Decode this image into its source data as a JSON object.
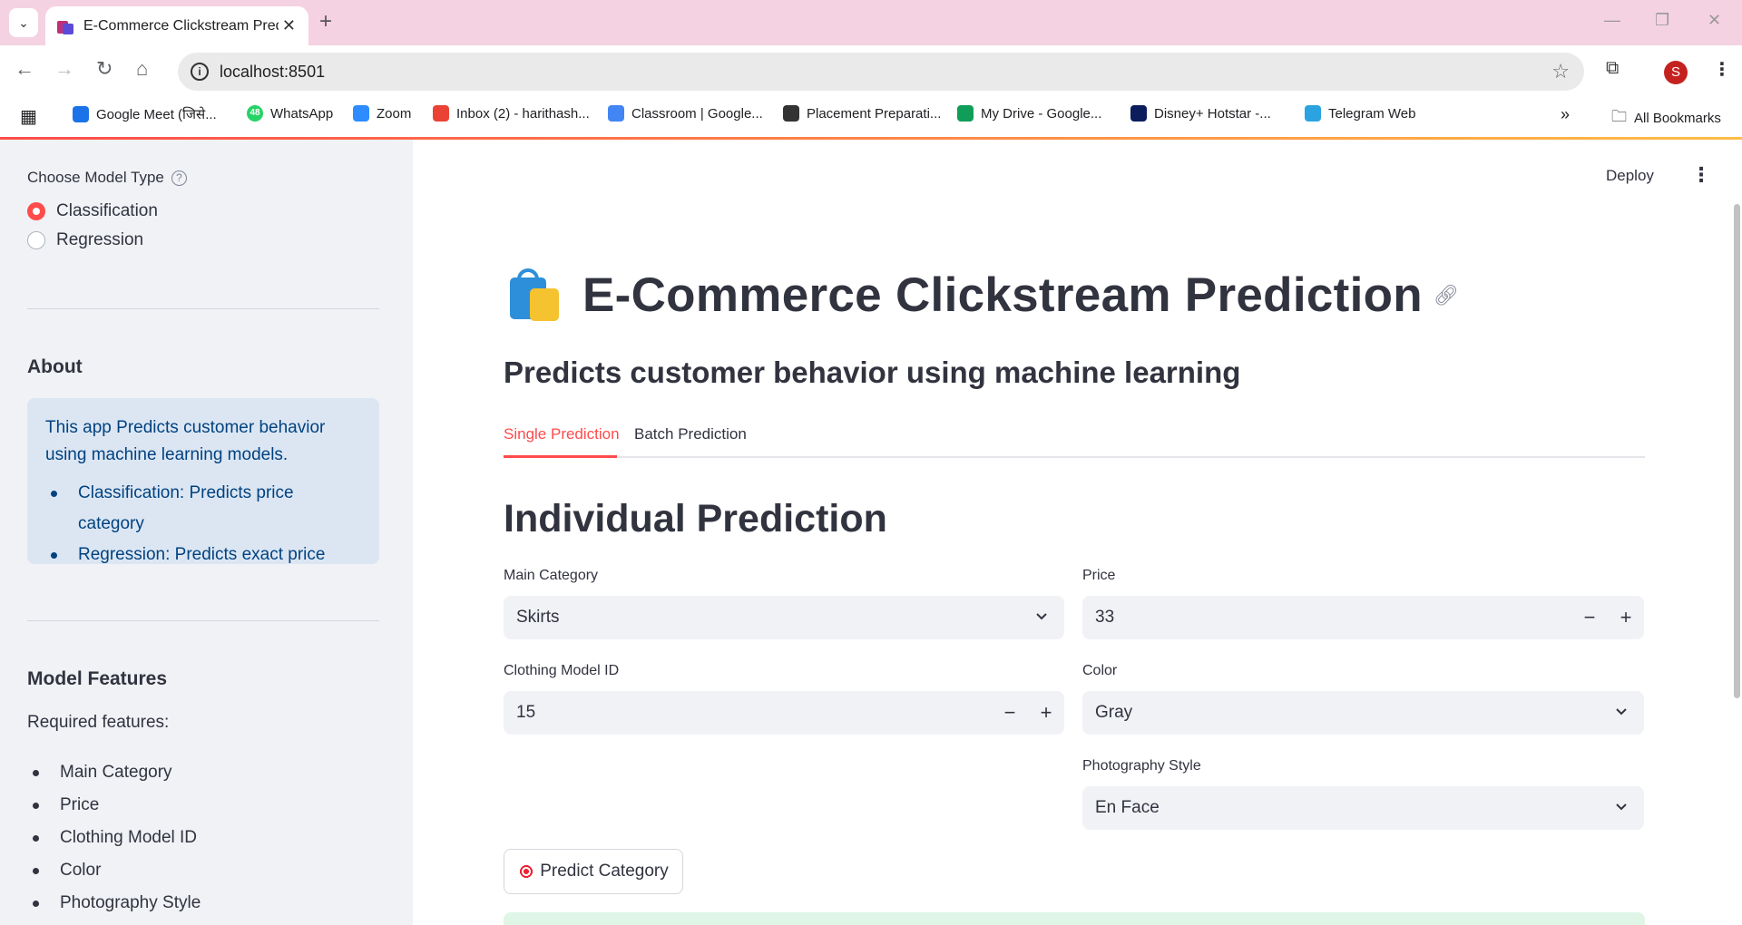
{
  "browser": {
    "tab_title": "E-Commerce Clickstream Predic",
    "url": "localhost:8501",
    "profile_initial": "S",
    "bookmarks": [
      {
        "label": "Google Meet (जिसे...",
        "icon": "google-meet-icon",
        "color": "#1a73e8"
      },
      {
        "label": "WhatsApp",
        "icon": "whatsapp-icon",
        "color": "#25d366",
        "badge": "48"
      },
      {
        "label": "Zoom",
        "icon": "zoom-icon",
        "color": "#2d8cff"
      },
      {
        "label": "Inbox (2) - harithash...",
        "icon": "gmail-icon",
        "color": "#ea4335"
      },
      {
        "label": "Classroom | Google...",
        "icon": "google-icon",
        "color": "#4285f4"
      },
      {
        "label": "Placement Preparati...",
        "icon": "globe-icon",
        "color": "#333333"
      },
      {
        "label": "My Drive - Google...",
        "icon": "google-drive-icon",
        "color": "#0f9d58"
      },
      {
        "label": "Disney+ Hotstar -...",
        "icon": "hotstar-icon",
        "color": "#0c1d5e"
      },
      {
        "label": "Telegram Web",
        "icon": "telegram-icon",
        "color": "#2aa3e0"
      }
    ],
    "all_bookmarks": "All Bookmarks"
  },
  "sidebar": {
    "model_type_label": "Choose Model Type",
    "options": [
      "Classification",
      "Regression"
    ],
    "selected": "Classification",
    "about_title": "About",
    "about_text": "This app Predicts customer behavior using machine learning models.",
    "about_items": [
      "Classification: Predicts price category",
      "Regression: Predicts exact price"
    ],
    "features_title": "Model Features",
    "features_intro": "Required features:",
    "features": [
      "Main Category",
      "Price",
      "Clothing Model ID",
      "Color",
      "Photography Style"
    ]
  },
  "header": {
    "deploy": "Deploy"
  },
  "main": {
    "title": "E-Commerce Clickstream Prediction",
    "subtitle": "Predicts customer behavior using machine learning",
    "tabs": [
      "Single Prediction",
      "Batch Prediction"
    ],
    "active_tab": "Single Prediction",
    "section_title": "Individual Prediction",
    "fields": {
      "main_category": {
        "label": "Main Category",
        "value": "Skirts"
      },
      "price": {
        "label": "Price",
        "value": "33"
      },
      "clothing_model_id": {
        "label": "Clothing Model ID",
        "value": "15"
      },
      "color": {
        "label": "Color",
        "value": "Gray"
      },
      "photography_style": {
        "label": "Photography Style",
        "value": "En Face"
      }
    },
    "predict_button": "Predict Category"
  },
  "colors": {
    "accent": "#ff4b4b",
    "sidebar_bg": "#f0f2f6",
    "info_bg": "#dce6f3",
    "info_text": "#004280"
  }
}
